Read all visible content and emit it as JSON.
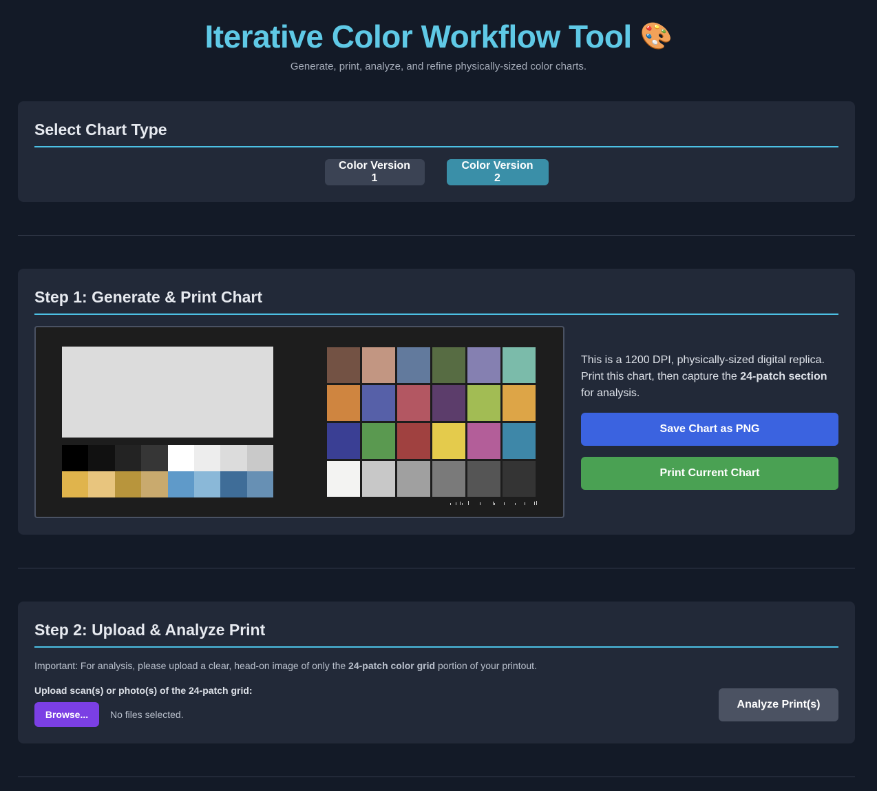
{
  "header": {
    "title": "Iterative Color Workflow Tool",
    "title_emoji": "🎨",
    "subtitle": "Generate, print, analyze, and refine physically-sized color charts."
  },
  "chart_type": {
    "heading": "Select Chart Type",
    "options": [
      "Color Version 1",
      "Color Version 2"
    ],
    "selected": "Color Version 2"
  },
  "step1": {
    "heading": "Step 1: Generate & Print Chart",
    "description_pre": "This is a 1200 DPI, physically-sized digital replica. Print this chart, then capture the ",
    "description_bold": "24-patch section",
    "description_post": " for analysis.",
    "save_button": "Save Chart as PNG",
    "print_button": "Print Current Chart",
    "chart": {
      "large_patch_color": "#dcdcdc",
      "gray_strip": [
        "#000000",
        "#111111",
        "#232323",
        "#363636",
        "#ffffff",
        "#ededed",
        "#dcdcdc",
        "#c9c9c9"
      ],
      "color_strip": [
        "#e0b44c",
        "#e8c57e",
        "#b8953c",
        "#c9aa6e",
        "#5f9ac9",
        "#8ab8d8",
        "#3f6d98",
        "#6790b4"
      ],
      "patches": [
        "#735244",
        "#c29682",
        "#627a9d",
        "#576c43",
        "#8580b1",
        "#7bbbaa",
        "#cf8540",
        "#5660a8",
        "#b35762",
        "#5c3d6b",
        "#a2bc54",
        "#dda547",
        "#3a3f94",
        "#5a9950",
        "#a04140",
        "#e4cb4c",
        "#b35e99",
        "#3e87a8",
        "#f3f3f2",
        "#c8c8c8",
        "#a0a0a0",
        "#7a7a7a",
        "#555555",
        "#343434"
      ]
    }
  },
  "step2": {
    "heading": "Step 2: Upload & Analyze Print",
    "note_pre": "Important: For analysis, please upload a clear, head-on image of only the ",
    "note_bold": "24-patch color grid",
    "note_post": " portion of your printout.",
    "upload_label": "Upload scan(s) or photo(s) of the 24-patch grid:",
    "browse_button": "Browse...",
    "file_status": "No files selected.",
    "analyze_button": "Analyze Print(s)"
  }
}
